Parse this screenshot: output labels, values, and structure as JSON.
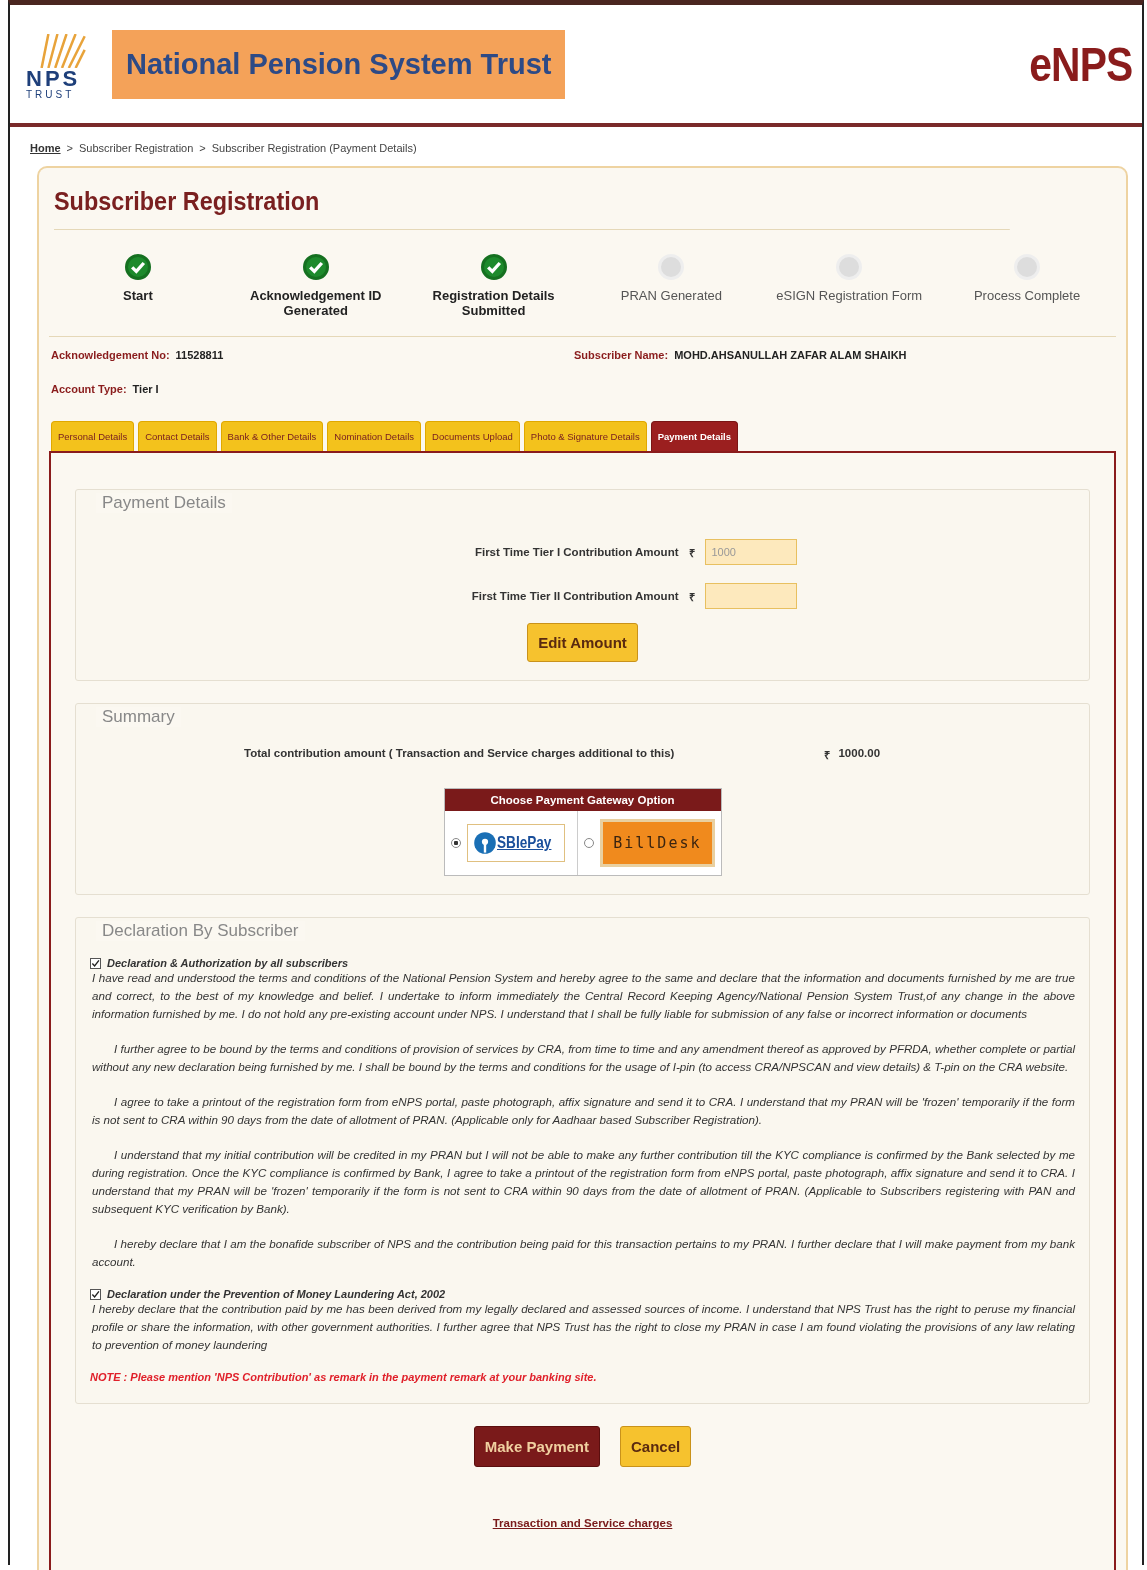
{
  "header": {
    "logo_text": "NPS",
    "logo_subtext": "TRUST",
    "title": "National Pension System Trust",
    "brand": "eNPS"
  },
  "breadcrumb": [
    {
      "label": "Home",
      "link": true
    },
    {
      "label": "Subscriber Registration",
      "link": false
    },
    {
      "label": "Subscriber Registration (Payment Details)",
      "link": false
    }
  ],
  "breadcrumb_separator": ">",
  "page_title": "Subscriber Registration",
  "steps": [
    {
      "label": "Start",
      "done": true
    },
    {
      "label": "Acknowledgement ID Generated",
      "done": true
    },
    {
      "label": "Registration Details Submitted",
      "done": true
    },
    {
      "label": "PRAN Generated",
      "done": false
    },
    {
      "label": "eSIGN Registration Form",
      "done": false
    },
    {
      "label": "Process Complete",
      "done": false
    }
  ],
  "info": {
    "acknowledgement_label": "Acknowledgement No:",
    "acknowledgement_value": "11528811",
    "subscriber_label": "Subscriber Name:",
    "subscriber_value": "MOHD.AHSANULLAH ZAFAR ALAM SHAIKH",
    "account_label": "Account Type:",
    "account_value": "Tier I"
  },
  "tabs": [
    {
      "label": "Personal Details",
      "selected": false
    },
    {
      "label": "Contact Details",
      "selected": false
    },
    {
      "label": "Bank & Other Details",
      "selected": false
    },
    {
      "label": "Nomination Details",
      "selected": false
    },
    {
      "label": "Documents Upload",
      "selected": false
    },
    {
      "label": "Photo & Signature Details",
      "selected": false
    },
    {
      "label": "Payment Details",
      "selected": true
    }
  ],
  "payment_details": {
    "legend": "Payment Details",
    "fields": [
      {
        "label": "First Time Tier I Contribution Amount",
        "currency": "₹",
        "value": "1000"
      },
      {
        "label": "First Time Tier II Contribution Amount",
        "currency": "₹"
      }
    ],
    "button": "Edit Amount"
  },
  "summary": {
    "legend": "Summary",
    "total_label": "Total contribution amount ( Transaction and Service charges additional to this)",
    "total_currency": "₹",
    "total_value": "1000.00",
    "gateway": {
      "title": "Choose Payment Gateway Option",
      "options": [
        {
          "kind": "sbi",
          "label": "SBIePay",
          "selected": true
        },
        {
          "kind": "billdesk",
          "label": "BillDesk",
          "selected": false
        }
      ]
    }
  },
  "declaration": {
    "legend": "Declaration By Subscriber",
    "sections": [
      {
        "checked": true,
        "title": "Declaration & Authorization by all subscribers",
        "paragraphs": [
          "I have read and understood the terms and conditions of the National Pension System and hereby agree to the same and declare that the information and documents furnished by me are true and correct, to the best of my knowledge and belief. I undertake to inform immediately the Central Record Keeping Agency/National Pension System Trust,of any change in the above information furnished by me. I do not hold any pre-existing account under NPS. I understand that I shall be fully liable for submission of any false or incorrect information or documents",
          "I further agree to be bound by the terms and conditions of provision of services by CRA, from time to time and any amendment thereof as approved by PFRDA, whether complete or partial without any new declaration being furnished by me. I shall be bound by the terms and conditions for the usage of I-pin (to access CRA/NPSCAN and view details) & T-pin on the CRA website.",
          "I agree to take a printout of the registration form from eNPS portal, paste photograph, affix signature and send it to CRA. I understand that my PRAN will be 'frozen' temporarily if the form is not sent to CRA within 90 days from the date of allotment of PRAN. (Applicable only for Aadhaar based Subscriber Registration).",
          "I understand that my initial contribution will be credited in my PRAN but I will not be able to make any further contribution till the KYC compliance is confirmed by the Bank selected by me during registration. Once the KYC compliance is confirmed by Bank, I agree to take a printout of the registration form from eNPS portal, paste photograph, affix signature and send it to CRA. I understand that my PRAN will be 'frozen' temporarily if the form is not sent to CRA within 90 days from the date of allotment of PRAN. (Applicable to Subscribers registering with PAN and subsequent KYC verification by Bank).",
          "I hereby declare that I am the bonafide subscriber of NPS and the contribution being paid for this transaction pertains to my PRAN. I further declare that I will make payment from my bank account."
        ]
      },
      {
        "checked": true,
        "title": "Declaration under the Prevention of Money Laundering Act, 2002",
        "paragraphs": [
          "I hereby declare that the contribution paid by me has been derived from my legally declared and assessed sources of income. I understand that NPS Trust has the right to peruse my financial profile or share the information, with other government authorities. I further agree that NPS Trust has the right to close my PRAN in case I am found violating the provisions of any law relating to prevention of money laundering"
        ]
      }
    ],
    "note": "NOTE : Please mention 'NPS Contribution' as remark in the payment remark at your banking site."
  },
  "buttons": [
    {
      "kind": "primary",
      "label": "Make Payment"
    },
    {
      "kind": "secondary",
      "label": "Cancel"
    }
  ],
  "footer_link": "Transaction and Service charges"
}
